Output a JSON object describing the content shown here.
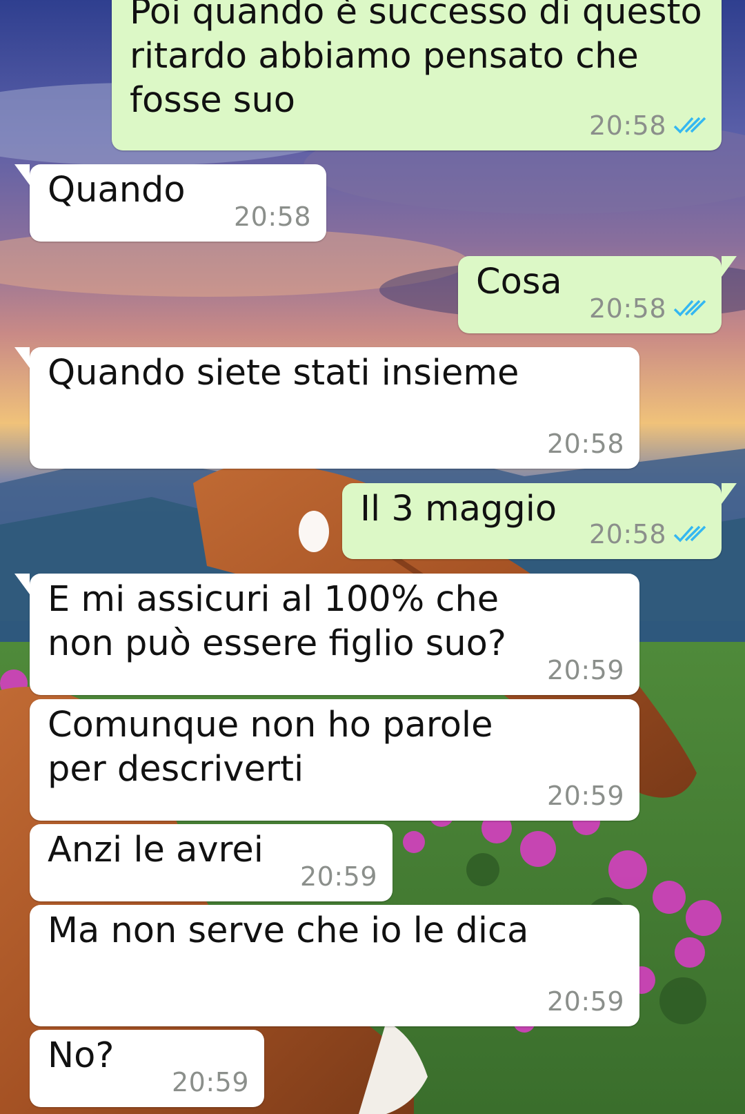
{
  "colors": {
    "incoming_bubble": "#ffffff",
    "outgoing_bubble": "#dcf8c6",
    "timestamp": "#8b8f8b",
    "read_ticks": "#34b7f1"
  },
  "wallpaper": {
    "description_icon": "horse-landscape-wallpaper"
  },
  "messages": [
    {
      "direction": "out",
      "text": "Poi quando è successo di questo ritardo abbiamo pensato che fosse suo",
      "time": "20:58",
      "status": "read"
    },
    {
      "direction": "in",
      "text": "Quando",
      "time": "20:58"
    },
    {
      "direction": "out",
      "text": "Cosa",
      "time": "20:58",
      "status": "read"
    },
    {
      "direction": "in",
      "text": "Quando siete stati insieme",
      "time": "20:58"
    },
    {
      "direction": "out",
      "text": "Il 3 maggio",
      "time": "20:58",
      "status": "read"
    },
    {
      "direction": "in",
      "text": "E mi assicuri al 100% che non può essere figlio suo?",
      "time": "20:59"
    },
    {
      "direction": "in",
      "text": "Comunque non ho parole per descriverti",
      "time": "20:59"
    },
    {
      "direction": "in",
      "text": "Anzi le avrei",
      "time": "20:59"
    },
    {
      "direction": "in",
      "text": "Ma non serve che io le dica",
      "time": "20:59"
    },
    {
      "direction": "in",
      "text": "No?",
      "time": "20:59"
    }
  ]
}
